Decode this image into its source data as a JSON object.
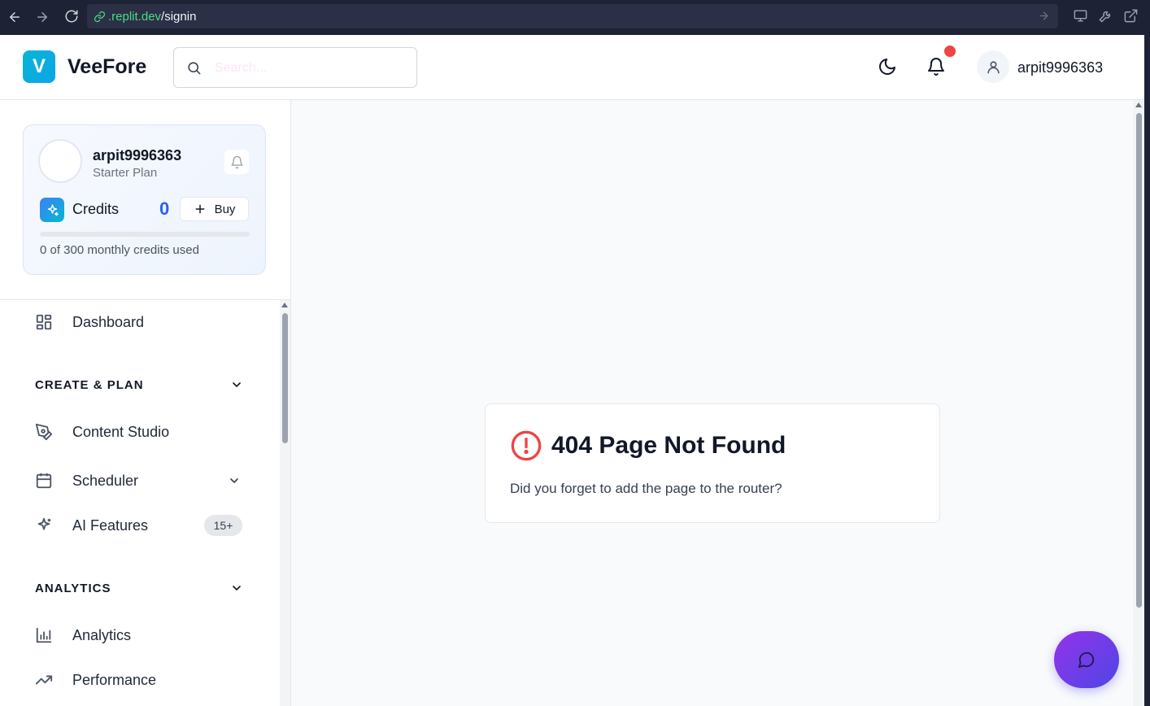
{
  "browser": {
    "url_domain": ".replit.dev",
    "url_path": "/signin"
  },
  "header": {
    "logo_letter": "V",
    "app_name": "VeeFore",
    "search_placeholder": "Search...",
    "username": "arpit9996363"
  },
  "profile_card": {
    "name": "arpit9996363",
    "plan": "Starter Plan",
    "credits_label": "Credits",
    "credits_value": "0",
    "buy_label": "Buy",
    "credits_used_fraction": 0.0,
    "credits_used_text": "0 of 300 monthly credits used"
  },
  "sidebar": {
    "dashboard": "Dashboard",
    "section_create": "CREATE & PLAN",
    "content_studio": "Content Studio",
    "scheduler": "Scheduler",
    "ai_features": "AI Features",
    "ai_badge": "15+",
    "section_analytics": "ANALYTICS",
    "analytics": "Analytics",
    "performance": "Performance"
  },
  "error": {
    "title": "404 Page Not Found",
    "message": "Did you forget to add the page to the router?"
  },
  "colors": {
    "accent": "#2563eb",
    "error": "#ef4444",
    "notification_dot": "#ef4444",
    "fab_gradient_start": "#9333ea",
    "fab_gradient_end": "#4f46e5"
  },
  "icons": {
    "back": "arrow-left-icon",
    "forward": "arrow-right-icon",
    "reload": "reload-icon",
    "search": "search-icon",
    "theme": "moon-icon",
    "notifications": "bell-icon",
    "user": "user-icon",
    "credits": "sparkles-icon",
    "dashboard": "grid-icon",
    "content_studio": "pen-tool-icon",
    "scheduler": "calendar-icon",
    "ai_features": "sparkles-icon",
    "analytics": "bar-chart-icon",
    "performance": "trending-up-icon",
    "error": "alert-circle-icon",
    "chat": "chat-icon"
  }
}
